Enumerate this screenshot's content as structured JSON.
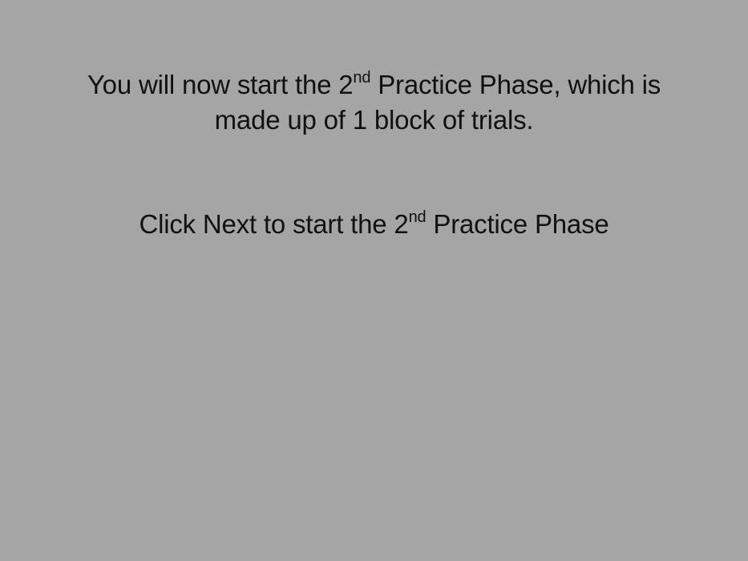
{
  "instructions": {
    "intro": {
      "line1_before": "You will now start the 2",
      "line1_sup": "nd",
      "line1_after": " Practice Phase, which is",
      "line2": "made up of 1 block of trials."
    },
    "prompt": {
      "before": "Click Next to start the 2",
      "sup": "nd",
      "after": " Practice Phase"
    }
  },
  "colors": {
    "background": "#a5a5a5",
    "text": "#111111"
  }
}
